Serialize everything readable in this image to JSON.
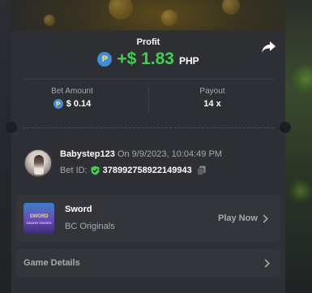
{
  "profit": {
    "label": "Profit",
    "amount": "+$ 1.83",
    "currency": "PHP",
    "coin_symbol": "₱"
  },
  "stats": {
    "bet_amount_label": "Bet Amount",
    "bet_amount_value": "$ 0.14",
    "payout_label": "Payout",
    "payout_value": "14 x"
  },
  "bet": {
    "username": "Babystep123",
    "on_text": "On 9/9/2023, 10:04:49 PM",
    "bet_id_label": "Bet ID:",
    "bet_id": "378992758922149943"
  },
  "game": {
    "name": "Sword",
    "category": "BC Originals",
    "play_label": "Play Now",
    "thumb_title": "SWORD",
    "thumb_subtitle": "SAVIOR SWORD"
  },
  "details": {
    "label": "Game Details"
  },
  "colors": {
    "profit_green": "#3fd14a",
    "panel_bg": "#2e3035",
    "page_bg": "#1c1e23"
  },
  "icons": [
    "peso-coin-icon",
    "share-icon",
    "shield-check-icon",
    "copy-icon",
    "chevron-right-icon"
  ]
}
